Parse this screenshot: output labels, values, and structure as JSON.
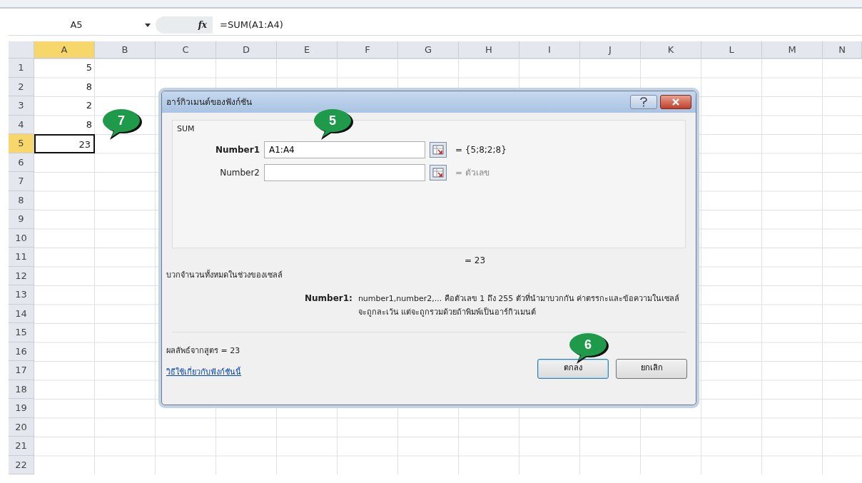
{
  "formula_bar": {
    "name_box": "A5",
    "fx_label": "fx",
    "formula": "=SUM(A1:A4)"
  },
  "columns": [
    {
      "label": "A",
      "selected": true
    },
    {
      "label": "B",
      "selected": false
    },
    {
      "label": "C",
      "selected": false
    },
    {
      "label": "D",
      "selected": false
    },
    {
      "label": "E",
      "selected": false
    },
    {
      "label": "F",
      "selected": false
    },
    {
      "label": "G",
      "selected": false
    },
    {
      "label": "H",
      "selected": false
    },
    {
      "label": "I",
      "selected": false
    },
    {
      "label": "J",
      "selected": false
    },
    {
      "label": "K",
      "selected": false
    },
    {
      "label": "L",
      "selected": false
    },
    {
      "label": "M",
      "selected": false
    },
    {
      "label": "N",
      "selected": false
    }
  ],
  "rows": [
    {
      "label": "1",
      "selected": false,
      "cells": [
        "5"
      ]
    },
    {
      "label": "2",
      "selected": false,
      "cells": [
        "8"
      ]
    },
    {
      "label": "3",
      "selected": false,
      "cells": [
        "2"
      ]
    },
    {
      "label": "4",
      "selected": false,
      "cells": [
        "8"
      ]
    },
    {
      "label": "5",
      "selected": true,
      "cells": [
        "23"
      ]
    },
    {
      "label": "6",
      "selected": false,
      "cells": []
    },
    {
      "label": "7",
      "selected": false,
      "cells": []
    },
    {
      "label": "8",
      "selected": false,
      "cells": []
    },
    {
      "label": "9",
      "selected": false,
      "cells": []
    },
    {
      "label": "10",
      "selected": false,
      "cells": []
    },
    {
      "label": "11",
      "selected": false,
      "cells": []
    },
    {
      "label": "12",
      "selected": false,
      "cells": []
    },
    {
      "label": "13",
      "selected": false,
      "cells": []
    },
    {
      "label": "14",
      "selected": false,
      "cells": []
    },
    {
      "label": "15",
      "selected": false,
      "cells": []
    },
    {
      "label": "16",
      "selected": false,
      "cells": []
    },
    {
      "label": "17",
      "selected": false,
      "cells": []
    },
    {
      "label": "18",
      "selected": false,
      "cells": []
    },
    {
      "label": "19",
      "selected": false,
      "cells": []
    },
    {
      "label": "20",
      "selected": false,
      "cells": []
    },
    {
      "label": "21",
      "selected": false,
      "cells": []
    },
    {
      "label": "22",
      "selected": false,
      "cells": []
    }
  ],
  "dialog": {
    "title": "อาร์กิวเมนต์ของฟังก์ชัน",
    "function_name": "SUM",
    "arguments": [
      {
        "label": "Number1",
        "value": "A1:A4",
        "result": "= {5;8;2;8}",
        "active": true
      },
      {
        "label": "Number2",
        "result": "= ตัวเลข",
        "active": false
      }
    ],
    "total": "= 23",
    "description": "บวกจำนวนทั้งหมดในช่วงของเซลล์",
    "help_label": "Number1:",
    "help_text": "number1,number2,... คือตัวเลข 1 ถึง 255 ตัวที่นำมาบวกกัน ค่าตรรกะและข้อความในเซลล์จะถูกละเว้น แต่จะถูกรวมด้วยถ้าพิมพ์เป็นอาร์กิวเมนต์",
    "formula_result": "ผลลัพธ์จากสูตร =  23",
    "help_link": "วิธีใช้เกี่ยวกับฟังก์ชันนี้",
    "buttons": [
      {
        "label": "ตกลง",
        "default": true
      },
      {
        "label": "ยกเลิก",
        "default": false
      }
    ]
  },
  "callouts": [
    {
      "label": "7"
    },
    {
      "label": "5"
    },
    {
      "label": "6"
    }
  ]
}
